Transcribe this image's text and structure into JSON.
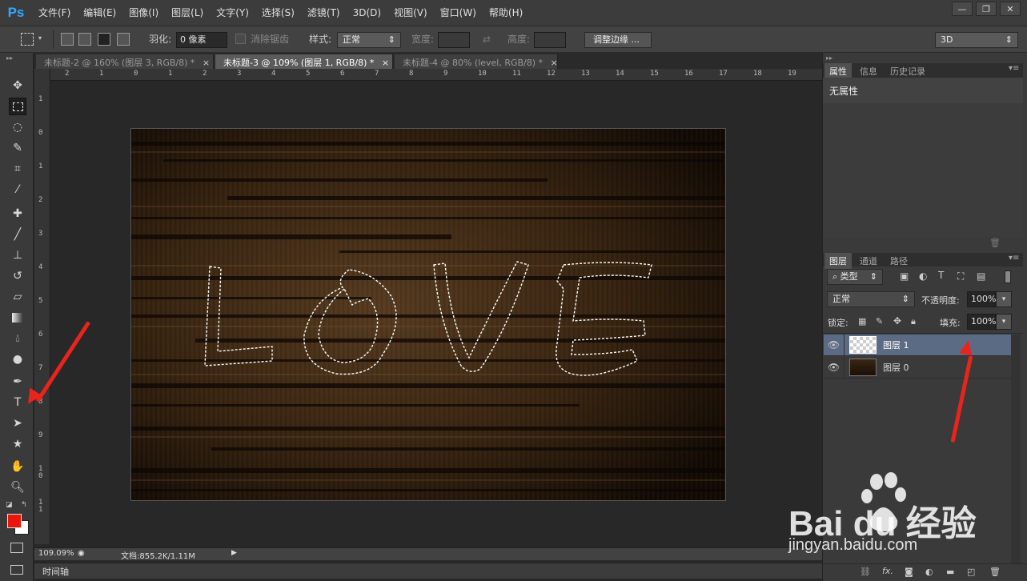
{
  "app": {
    "logo": "Ps"
  },
  "menu": [
    "文件(F)",
    "编辑(E)",
    "图像(I)",
    "图层(L)",
    "文字(Y)",
    "选择(S)",
    "滤镜(T)",
    "3D(D)",
    "视图(V)",
    "窗口(W)",
    "帮助(H)"
  ],
  "window_controls": {
    "minimize": "—",
    "restore": "❐",
    "close": "✕"
  },
  "options": {
    "feather_label": "羽化:",
    "feather_value": "0 像素",
    "antialias_label": "消除锯齿",
    "style_label": "样式:",
    "style_value": "正常",
    "width_label": "宽度:",
    "height_label": "高度:",
    "refine_button": "调整边缘 ...",
    "workspace_value": "3D"
  },
  "tabs": [
    {
      "label": "未标题-2 @ 160% (图层 3, RGB/8) *",
      "close": "×",
      "active": false
    },
    {
      "label": "未标题-3 @ 109% (图层 1, RGB/8) *",
      "close": "×",
      "active": true
    },
    {
      "label": "未标题-4 @ 80% (level, RGB/8) *",
      "close": "×",
      "active": false
    }
  ],
  "ruler_h": [
    "2",
    "1",
    "0",
    "1",
    "2",
    "3",
    "4",
    "5",
    "6",
    "7",
    "8",
    "9",
    "10",
    "11",
    "12",
    "13",
    "14",
    "15",
    "16",
    "17",
    "18",
    "19"
  ],
  "ruler_v": [
    "1",
    "0",
    "1",
    "2",
    "3",
    "4",
    "5",
    "6",
    "7",
    "8",
    "9",
    "1\n0",
    "1\n1"
  ],
  "canvas": {
    "text": "LOVE"
  },
  "status": {
    "zoom": "109.09%",
    "doc": "文档:855.2K/1.11M"
  },
  "timeline": {
    "label": "时间轴"
  },
  "properties": {
    "tabs": [
      "属性",
      "信息",
      "历史记录"
    ],
    "content": "无属性"
  },
  "layers_panel": {
    "tabs": [
      "图层",
      "通道",
      "路径"
    ],
    "filter_kind": "类型",
    "blend_mode": "正常",
    "opacity_label": "不透明度:",
    "opacity_value": "100%",
    "lock_label": "锁定:",
    "fill_label": "填充:",
    "fill_value": "100%",
    "layers": [
      {
        "name": "图层 1",
        "selected": true
      },
      {
        "name": "图层 0",
        "selected": false
      }
    ]
  },
  "watermark": {
    "brand": "Bai du 经验",
    "url": "jingyan.baidu.com"
  },
  "colors": {
    "accent": "#31a8ff",
    "foreground": "#e8160c",
    "background": "#ffffff",
    "annotation_arrow": "#e8241c"
  }
}
